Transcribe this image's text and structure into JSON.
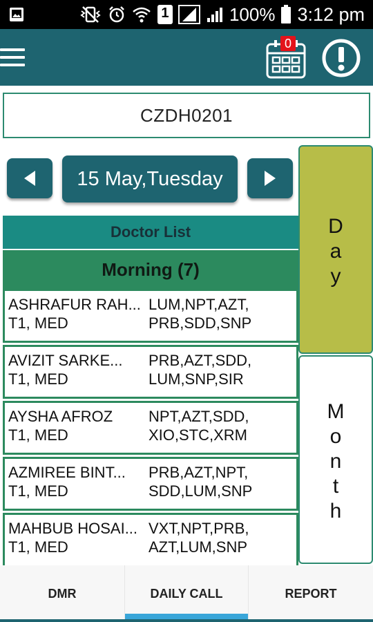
{
  "status_bar": {
    "battery": "100%",
    "time": "3:12 pm",
    "sim_label": "1"
  },
  "app_bar": {
    "calendar_badge": "0",
    "icons": [
      "menu-icon",
      "calendar-icon",
      "alert-icon"
    ]
  },
  "code_field": {
    "value": "CZDH0201"
  },
  "date_nav": {
    "current": "15 May,Tuesday"
  },
  "toggles": {
    "day": "Day",
    "month": "Month"
  },
  "doctor_list": {
    "header": "Doctor List",
    "section": "Morning (7)",
    "rows": [
      {
        "name": "ASHRAFUR RAH...",
        "sub": "T1, MED",
        "products_1": "LUM,NPT,AZT,",
        "products_2": "PRB,SDD,SNP"
      },
      {
        "name": "AVIZIT SARKE...",
        "sub": "T1, MED",
        "products_1": "PRB,AZT,SDD,",
        "products_2": "LUM,SNP,SIR"
      },
      {
        "name": "AYSHA AFROZ",
        "sub": "T1, MED",
        "products_1": "NPT,AZT,SDD,",
        "products_2": "XIO,STC,XRM"
      },
      {
        "name": "AZMIREE BINT...",
        "sub": "T1, MED",
        "products_1": "PRB,AZT,NPT,",
        "products_2": "SDD,LUM,SNP"
      },
      {
        "name": "MAHBUB HOSAI...",
        "sub": "T1, MED",
        "products_1": "VXT,NPT,PRB,",
        "products_2": "AZT,LUM,SNP"
      }
    ]
  },
  "tabs": {
    "dmr": "DMR",
    "daily_call": "DAILY CALL",
    "report": "REPORT",
    "active": "DAILY CALL"
  },
  "colors": {
    "primary": "#1e6470",
    "accent_green": "#2c8a5e",
    "header_teal": "#1a8b83",
    "day_active": "#b7bd48",
    "tab_indicator": "#39a6d9",
    "badge_red": "#e3131b"
  }
}
